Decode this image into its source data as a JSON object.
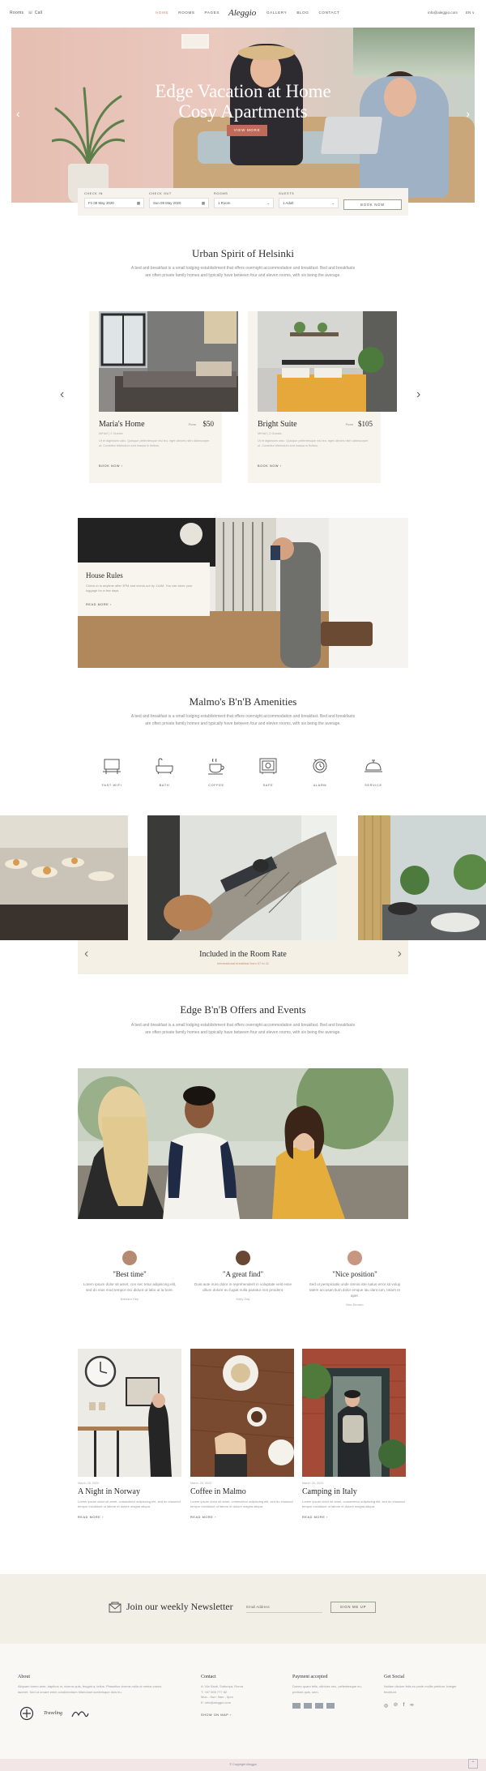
{
  "topbar": {
    "left": [
      "Rooms",
      "Call"
    ],
    "nav": [
      "HOME",
      "ROOMS",
      "PAGES"
    ],
    "nav_right": [
      "GALLERY",
      "BLOG",
      "CONTACT"
    ],
    "logo": "Aleggio",
    "email": "info@aleggio.com",
    "lang": "EN ∨"
  },
  "hero": {
    "title_line1": "Edge Vacation at Home",
    "title_line2": "Cosy Apartments",
    "button": "VIEW MORE"
  },
  "booking": {
    "checkin_label": "CHECK IN",
    "checkin_value": "Fri 08 May 2020",
    "checkout_label": "CHECK OUT",
    "checkout_value": "Sun 09 May 2020",
    "rooms_label": "ROOMS",
    "rooms_value": "1 Room",
    "guests_label": "GUESTS",
    "guests_value": "1 Adult",
    "button": "BOOK NOW"
  },
  "intro": {
    "title": "Urban Spirit of Helsinki",
    "text": "A bed and breakfast is a small lodging establishment that offers overnight accommodation and breakfast. Bed and breakfasts are often private family homes and typically have between four and eleven rooms, with six being the average."
  },
  "rooms": [
    {
      "name": "Maria's Home",
      "from": "From",
      "price": "$50",
      "meta": "M/Ha2 | 2 Guests",
      "desc": "Ut et dignissim odio. Quisque pellentesque nisl leo, eget ultrices nibh ullamcorper ut. Curabitur bibendum sed massa in finibus.",
      "more": "BOOK NOW"
    },
    {
      "name": "Bright Suite",
      "from": "From",
      "price": "$105",
      "meta": "M/Ha2 | 2 Guests",
      "desc": "Ut et dignissim odio. Quisque pellentesque nisl leo, eget ultrices nibh ullamcorper ut. Curabitur bibendum sed massa in finibus.",
      "more": "BOOK NOW"
    }
  ],
  "rules": {
    "title": "House Rules",
    "text": "Check-in is anytime after 3PM and check-out by 11AM. You can store your luggage for a few days.",
    "more": "READ MORE"
  },
  "amenities": {
    "title": "Malmo's B'n'B Amenities",
    "text": "A bed and breakfast is a small lodging establishment that offers overnight accommodation and breakfast. Bed and breakfasts are often private family homes and typically have between four and eleven rooms, with six being the average.",
    "items": [
      "FAST WIFI",
      "BATH",
      "COFFEE",
      "SAFE",
      "ALARM",
      "SERVICE"
    ]
  },
  "gallery": {
    "title": "Included in the Room Rate",
    "subtitle": "International breakfast from 07 to 11"
  },
  "offers": {
    "title": "Edge B'n'B Offers and Events",
    "text": "A bed and breakfast is a small lodging establishment that offers overnight accommodation and breakfast. Bed and breakfasts are often private family homes and typically have between four and eleven rooms, with six being the average."
  },
  "testimonials": [
    {
      "quote": "\"Best time\"",
      "text": "Lorem ipsum dolor sit amet, con sec tetur adipiscing elit, sed do eius mod tempor inci didunt ut labo ut la bore.",
      "name": "Barbara Hep"
    },
    {
      "quote": "\"A great find\"",
      "text": "Duis aute irure dolor in reprehenderit in voluptate velit esse cillum dolore eu fugiat nulla pariatur non proident.",
      "name": "Mary Day"
    },
    {
      "quote": "\"Nice position\"",
      "text": "Sed ut perspiciatis unde omnis iste natus error sit volup tatem accusan tium dolor emque lau dant ium, totam re aper.",
      "name": "Max Bender"
    }
  ],
  "blog": [
    {
      "date": "March 26, 2020",
      "title": "A Night in Norway",
      "excerpt": "Lorem ipsum dolor sit amet, consectetur adipiscing elit, sed do eiusmod tempor incididunt ut labore et dolore magna aliqua.",
      "more": "READ MORE"
    },
    {
      "date": "March 26, 2020",
      "title": "Coffee in Malmo",
      "excerpt": "Lorem ipsum dolor sit amet, consectetur adipiscing elit, sed do eiusmod tempor incididunt ut labore et dolore magna aliqua.",
      "more": "READ MORE"
    },
    {
      "date": "March 26, 2020",
      "title": "Camping in Italy",
      "excerpt": "Lorem ipsum dolor sit amet, consectetur adipiscing elit, sed do eiusmod tempor incididunt ut labore et dolore magna aliqua.",
      "more": "READ MORE"
    }
  ],
  "newsletter": {
    "title": "Join our weekly Newsletter",
    "placeholder": "Email Address",
    "button": "SIGN ME UP"
  },
  "footer": {
    "about_title": "About",
    "about_text": "Aliquam lorem ante, dapibus in, viverra quis, feugiat a, tellus. Phasellus viverra nulla ut metus varius laoreet. Sed ut ornare enim condimentum bibendum scelerisque duis eu.",
    "brands": [
      "Traveling"
    ],
    "contact_title": "Contact",
    "contact_lines": [
      "A: Via Santi, Sottoripa, Roma",
      "T: +87 555 777 82",
      "Mon - Sun: 9am - 6pm",
      "E: info@aleggio.com"
    ],
    "contact_more": "SHOW ON MAP",
    "payment_title": "Payment accepted",
    "payment_text": "Donec quam felis, ultricies nec, pellentesque eu, pretium quis, sem.",
    "social_title": "Get Social",
    "social_text": "Nullam dictum felis eu pede mollis pretium. Integer tincidunt.",
    "copyright": "© Copyright Aleggio"
  },
  "colors": {
    "accent": "#c06a5a",
    "cream": "#f4f0e6",
    "text": "#2e2e2e"
  }
}
